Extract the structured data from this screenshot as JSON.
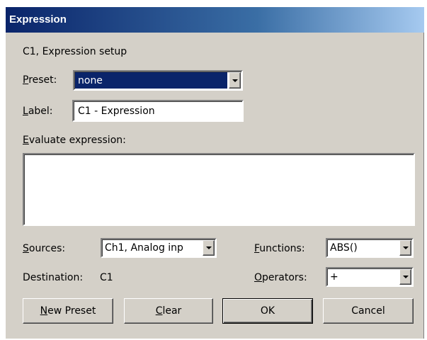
{
  "window": {
    "title": "Expression"
  },
  "header": {
    "subtitle": "C1, Expression setup"
  },
  "preset": {
    "label_prefix": "",
    "label_accel": "P",
    "label_rest": "reset:",
    "value": "none",
    "highlight_color": "#0a246a"
  },
  "label_field": {
    "label_accel": "L",
    "label_rest": "abel:",
    "value": "C1 - Expression"
  },
  "evaluate": {
    "label_accel": "E",
    "label_rest": "valuate expression:",
    "value": ""
  },
  "sources": {
    "label_accel": "S",
    "label_rest": "ources:",
    "value": "Ch1, Analog inp"
  },
  "functions": {
    "label_accel": "F",
    "label_rest": "unctions:",
    "value": "ABS()"
  },
  "destination": {
    "label": "Destination:",
    "value": "C1"
  },
  "operators": {
    "label_accel": "O",
    "label_rest": "perators:",
    "value": "+"
  },
  "buttons": {
    "new_preset_accel": "N",
    "new_preset_rest": "ew Preset",
    "clear_accel": "C",
    "clear_rest": "lear",
    "ok": "OK",
    "cancel": "Cancel"
  },
  "icons": {
    "dropdown": "chevron-down-icon"
  },
  "colors": {
    "dialog_bg": "#d4d0c8",
    "title_gradient_start": "#0a246a",
    "title_gradient_end": "#a6caf0"
  }
}
